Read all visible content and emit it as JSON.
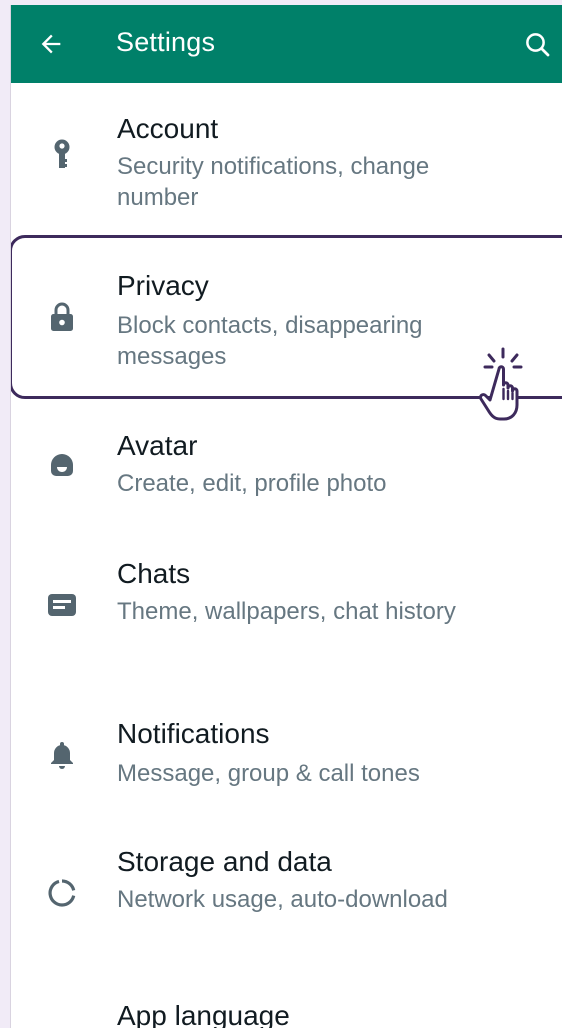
{
  "appbar": {
    "title": "Settings",
    "back_icon": "arrow-left-icon",
    "search_icon": "search-icon",
    "color": "#008069"
  },
  "items": [
    {
      "icon": "key-icon",
      "title": "Account",
      "subtitle": "Security notifications, change number"
    },
    {
      "icon": "lock-icon",
      "title": "Privacy",
      "subtitle": "Block contacts, disappearing messages"
    },
    {
      "icon": "avatar-icon",
      "title": "Avatar",
      "subtitle": "Create, edit, profile photo"
    },
    {
      "icon": "chat-icon",
      "title": "Chats",
      "subtitle": "Theme, wallpapers, chat history"
    },
    {
      "icon": "bell-icon",
      "title": "Notifications",
      "subtitle": "Message, group & call tones"
    },
    {
      "icon": "storage-icon",
      "title": "Storage and data",
      "subtitle": "Network usage, auto-download"
    },
    {
      "icon": "globe-icon",
      "title": "App language",
      "subtitle": ""
    }
  ],
  "highlight_color": "#3d2a5c",
  "pointer_icon": "hand-pointer-icon"
}
